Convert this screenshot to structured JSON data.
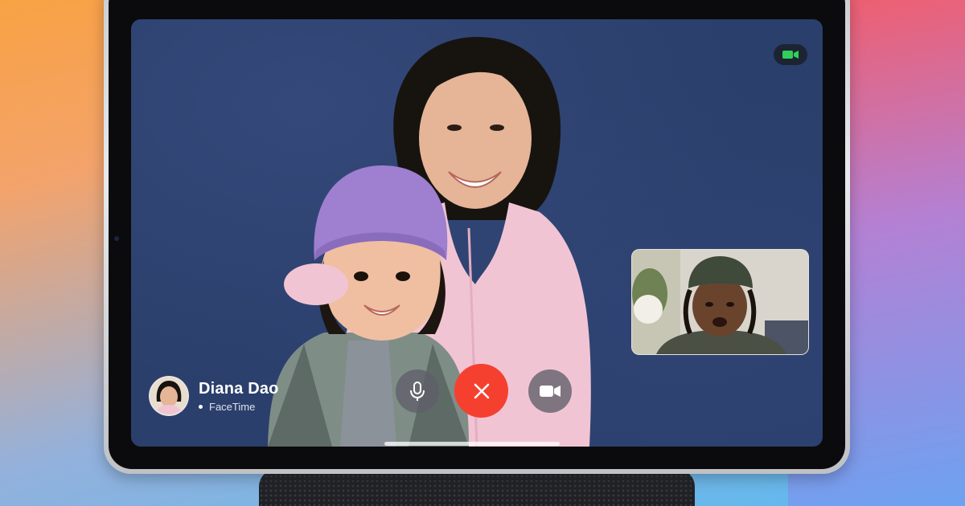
{
  "call": {
    "caller_name": "Diana Dao",
    "caller_app": "FaceTime"
  },
  "controls": {
    "mute": "microphone-icon",
    "end": "close-x-icon",
    "video": "video-camera-icon"
  },
  "colors": {
    "end_call": "#f6402f",
    "camera_active": "#30d158",
    "screen_bg": "#2b3f6c"
  }
}
